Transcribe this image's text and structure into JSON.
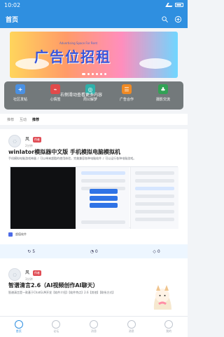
{
  "status": {
    "time": "10:02"
  },
  "appbar": {
    "title": "首页"
  },
  "banner": {
    "slogan": "广告位招租",
    "subtitle": "Advertising Space For Rent"
  },
  "shortcuts": [
    {
      "label": "社区发帖",
      "color": "#4a90e2",
      "icon": "+"
    },
    {
      "label": "心情签",
      "color": "#e14a4a",
      "icon": "⌁"
    },
    {
      "label": "周公解梦",
      "color": "#2fb0aa",
      "icon": "◎"
    },
    {
      "label": "广告合作",
      "color": "#f08a24",
      "icon": "☰"
    },
    {
      "label": "摄影交流",
      "color": "#31a255",
      "icon": "♣"
    }
  ],
  "shortcut_overlay": "右侧滑动查看更多内容",
  "tabs": [
    "推荐",
    "互动",
    "推荐"
  ],
  "posts": [
    {
      "author": "风",
      "badge": "作者",
      "time": "2分钟",
      "title": "winlator模拟器中文版 手机模拟电脑模拟机",
      "desc": "手机模拟电脑游戏神器 ♪ 可以带来超酷的使用体验，完美兼容各种电脑软件 ♪ 可以运行各种电脑游戏。",
      "sponsor": "超值软件",
      "actions": {
        "like": "5",
        "comment": "0",
        "share": "0"
      }
    },
    {
      "author": "风",
      "badge": "作者",
      "time": "3分钟",
      "title": "智谱清言2.6（AI视频创作AI聊天）",
      "desc": "智谱清言是一款基于ChatGLM开发【软件介绍】【软件特点】2.6【其他】【联系方式】"
    }
  ],
  "bottom_nav": [
    "首页",
    "论坛",
    "消息",
    "消息",
    "我的"
  ]
}
